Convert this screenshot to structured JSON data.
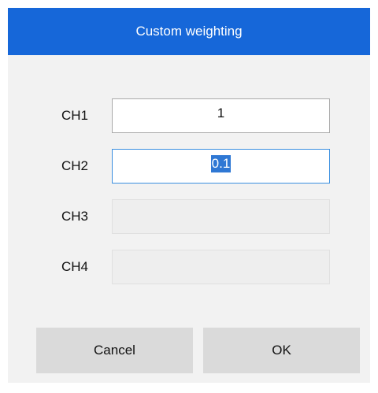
{
  "dialog": {
    "title": "Custom weighting",
    "accent_color": "#1667d9"
  },
  "channels": [
    {
      "label": "CH1",
      "value": "1",
      "state": "enabled"
    },
    {
      "label": "CH2",
      "value": "0.1",
      "state": "focused-selected"
    },
    {
      "label": "CH3",
      "value": "",
      "state": "disabled"
    },
    {
      "label": "CH4",
      "value": "",
      "state": "disabled"
    }
  ],
  "buttons": {
    "cancel_label": "Cancel",
    "ok_label": "OK"
  }
}
